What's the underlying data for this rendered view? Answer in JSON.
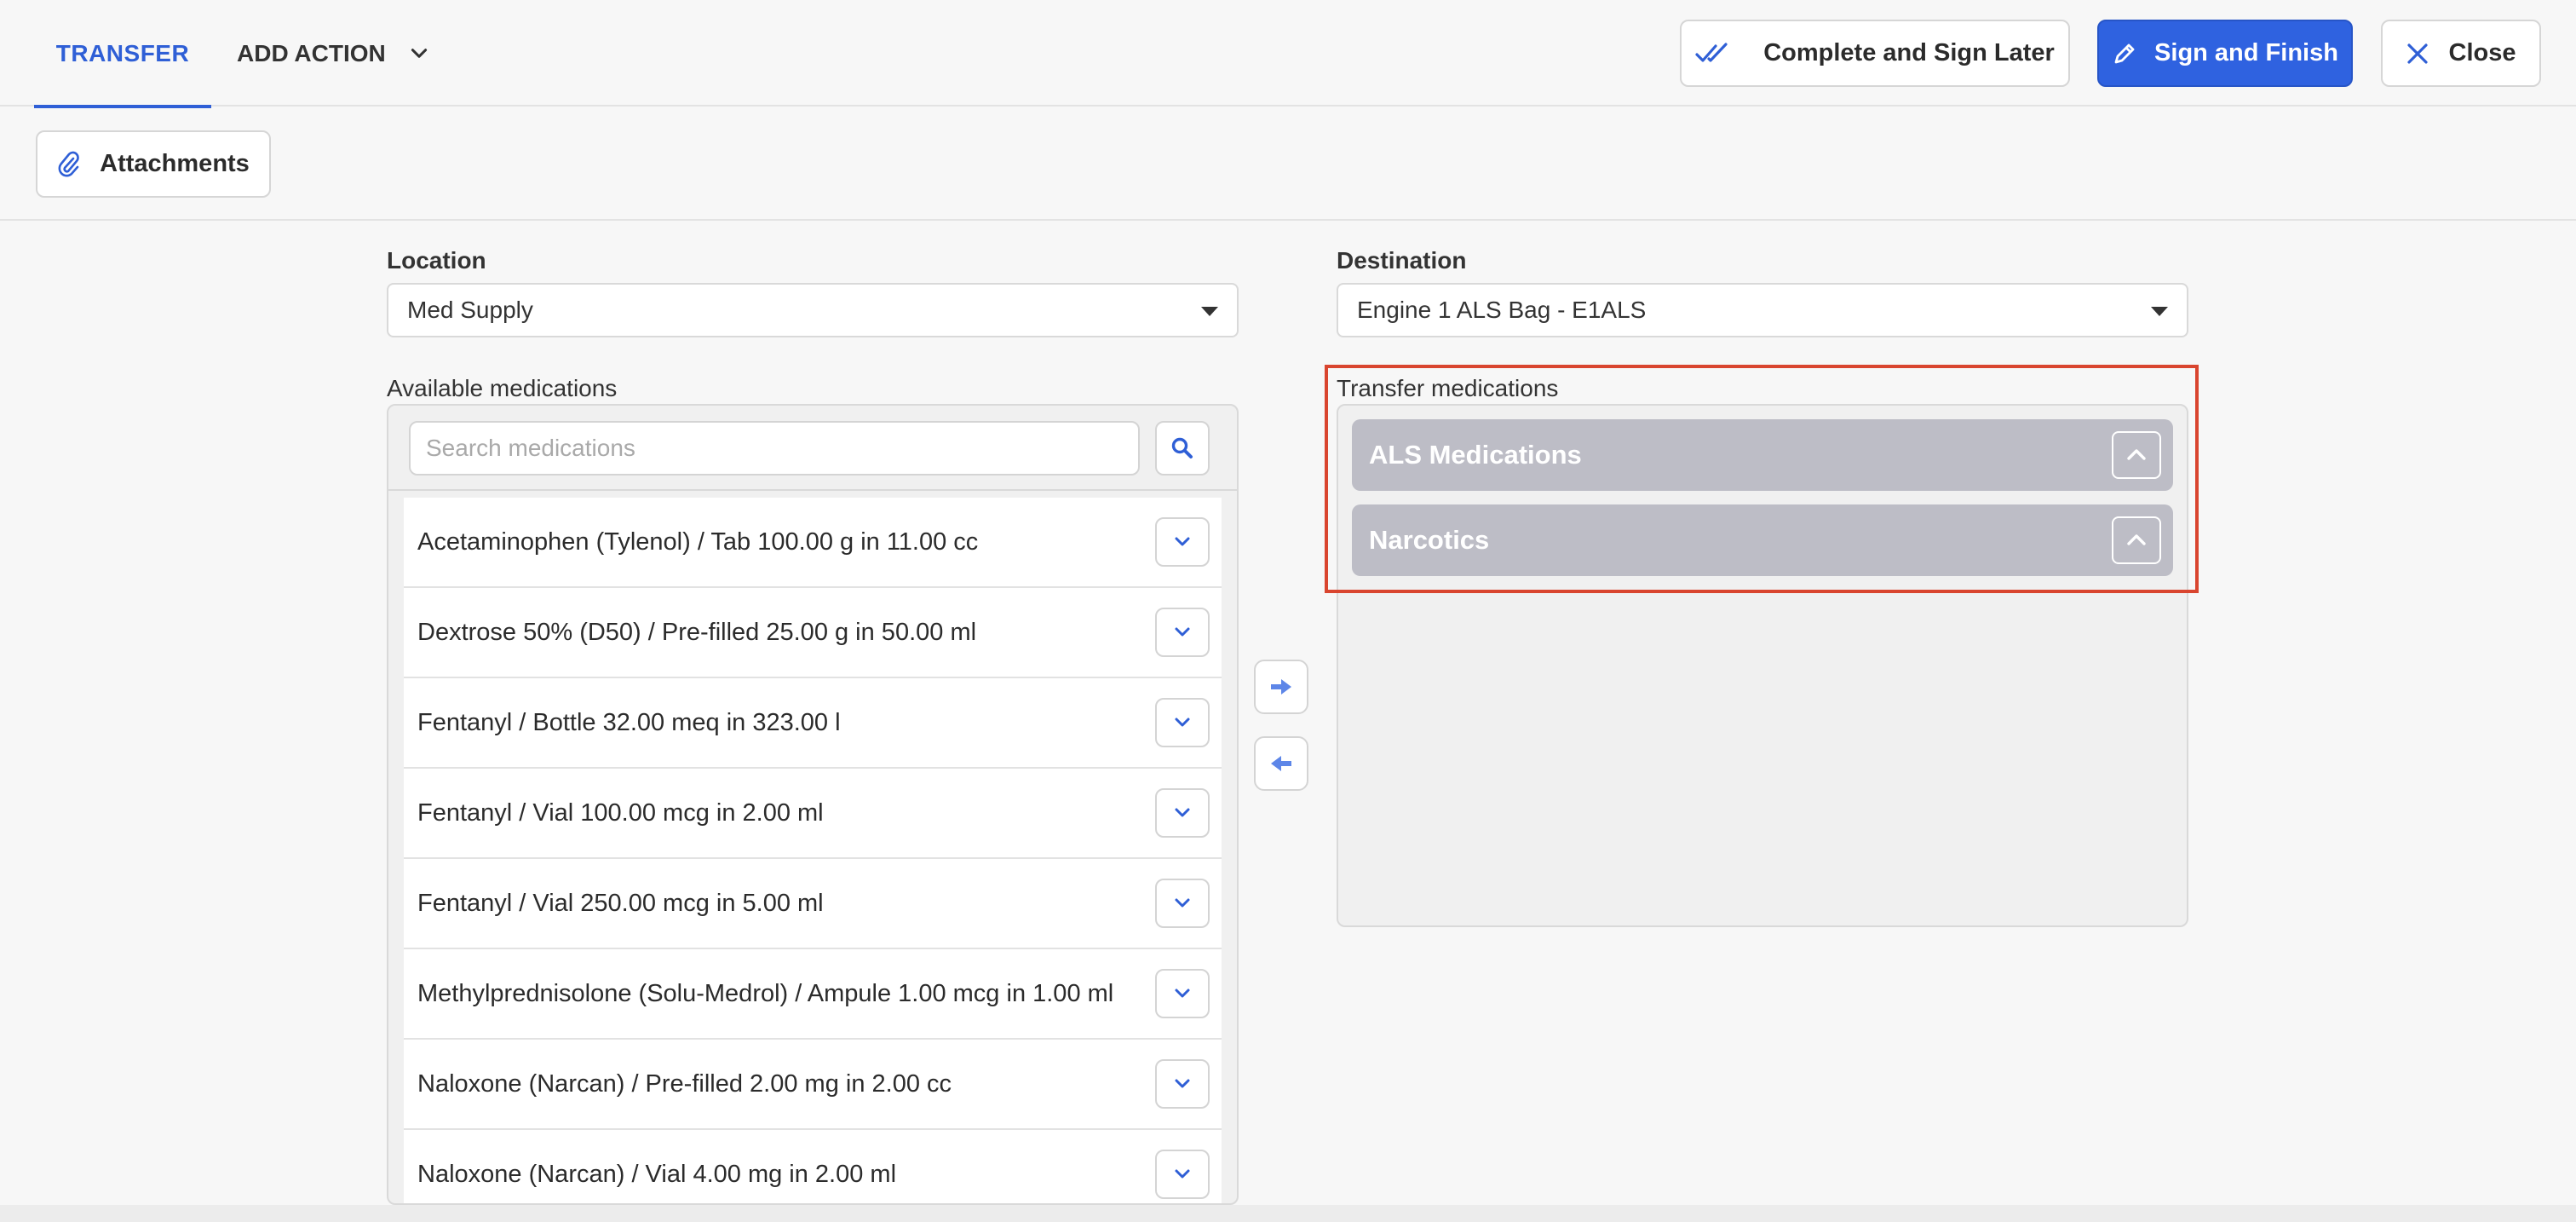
{
  "header": {
    "tab_transfer": "TRANSFER",
    "tab_add_action": "ADD ACTION",
    "btn_complete_later": "Complete and Sign Later",
    "btn_sign_finish": "Sign and Finish",
    "btn_close": "Close"
  },
  "toolbar": {
    "attachments": "Attachments"
  },
  "form": {
    "location_label": "Location",
    "location_value": "Med Supply",
    "destination_label": "Destination",
    "destination_value": "Engine 1 ALS Bag - E1ALS"
  },
  "available": {
    "label": "Available medications",
    "search_placeholder": "Search medications",
    "items": [
      "Acetaminophen (Tylenol) / Tab 100.00 g in 11.00 cc",
      "Dextrose 50% (D50) / Pre-filled 25.00 g in 50.00 ml",
      "Fentanyl / Bottle 32.00 meq in 323.00 l",
      "Fentanyl / Vial 100.00 mcg in 2.00 ml",
      "Fentanyl / Vial 250.00 mcg in 5.00 ml",
      "Methylprednisolone (Solu-Medrol) / Ampule 1.00 mcg in 1.00 ml",
      "Naloxone (Narcan) / Pre-filled 2.00 mg in 2.00 cc",
      "Naloxone (Narcan) / Vial 4.00 mg in 2.00 ml"
    ]
  },
  "transfer": {
    "label": "Transfer medications",
    "groups": [
      "ALS Medications",
      "Narcotics"
    ]
  },
  "colors": {
    "accent": "#2f62e0",
    "highlight": "#d9452f",
    "group_bg": "#bdbdc6"
  }
}
